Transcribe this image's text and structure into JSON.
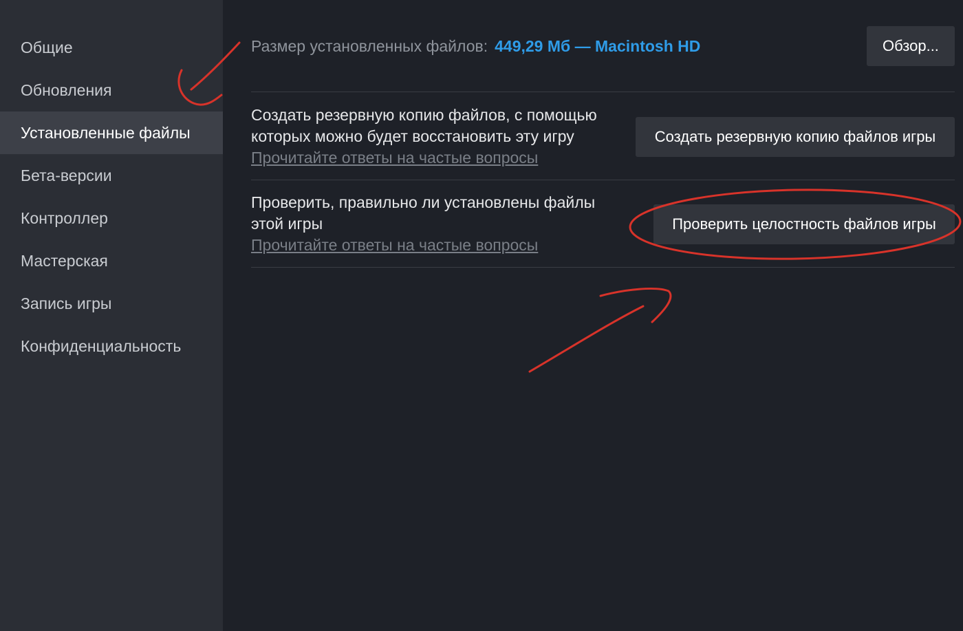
{
  "sidebar": {
    "items": [
      {
        "label": "Общие"
      },
      {
        "label": "Обновления"
      },
      {
        "label": "Установленные файлы"
      },
      {
        "label": "Бета-версии"
      },
      {
        "label": "Контроллер"
      },
      {
        "label": "Мастерская"
      },
      {
        "label": "Запись игры"
      },
      {
        "label": "Конфиденциальность"
      }
    ],
    "active_index": 2
  },
  "main": {
    "size_label": "Размер установленных файлов:",
    "size_value": "449,29 Мб — Macintosh HD",
    "browse_button": "Обзор...",
    "backup": {
      "description": "Создать резервную копию файлов, с помощью которых можно будет восстановить эту игру",
      "faq_link": "Прочитайте ответы на частые вопросы",
      "button": "Создать резервную копию файлов игры"
    },
    "verify": {
      "description": "Проверить, правильно ли установлены файлы этой игры",
      "faq_link": "Прочитайте ответы на частые вопросы",
      "button": "Проверить целостность файлов игры"
    }
  },
  "colors": {
    "sidebar_bg": "#2b2e35",
    "main_bg": "#1e2128",
    "active_item_bg": "#3d4048",
    "accent_blue": "#2f9ce8",
    "annotation_red": "#d8332a"
  }
}
